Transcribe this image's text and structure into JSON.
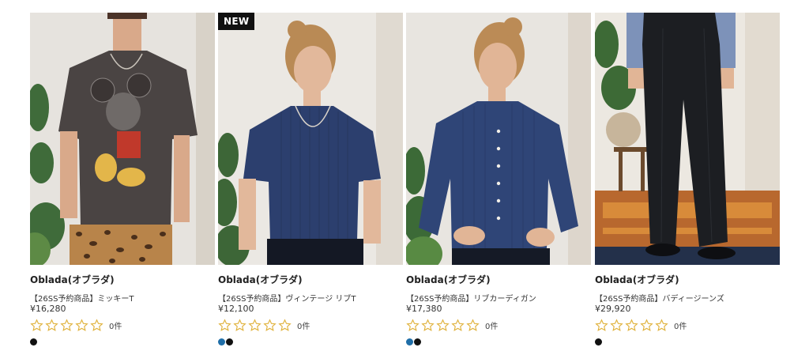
{
  "products": [
    {
      "brand": "Oblada(オブラダ)",
      "title": "【26SS予約商品】ミッキーT",
      "price": "¥16,280",
      "review_count": "0件",
      "badge": "",
      "swatches": [
        "#111111"
      ]
    },
    {
      "brand": "Oblada(オブラダ)",
      "title": "【26SS予約商品】ヴィンテージ リブT",
      "price": "¥12,100",
      "review_count": "0件",
      "badge": "NEW",
      "swatches": [
        "#1f6ea8",
        "#111111"
      ]
    },
    {
      "brand": "Oblada(オブラダ)",
      "title": "【26SS予約商品】リブカーディガン",
      "price": "¥17,380",
      "review_count": "0件",
      "badge": "",
      "swatches": [
        "#1f6ea8",
        "#111111"
      ]
    },
    {
      "brand": "Oblada(オブラダ)",
      "title": "【26SS予約商品】バディージーンズ",
      "price": "¥29,920",
      "review_count": "0件",
      "badge": "",
      "swatches": [
        "#111111"
      ]
    }
  ],
  "colors": {
    "star": "#e0b23c",
    "badge_bg": "#111111"
  },
  "icons": {
    "rating": "star-outline-icon"
  }
}
